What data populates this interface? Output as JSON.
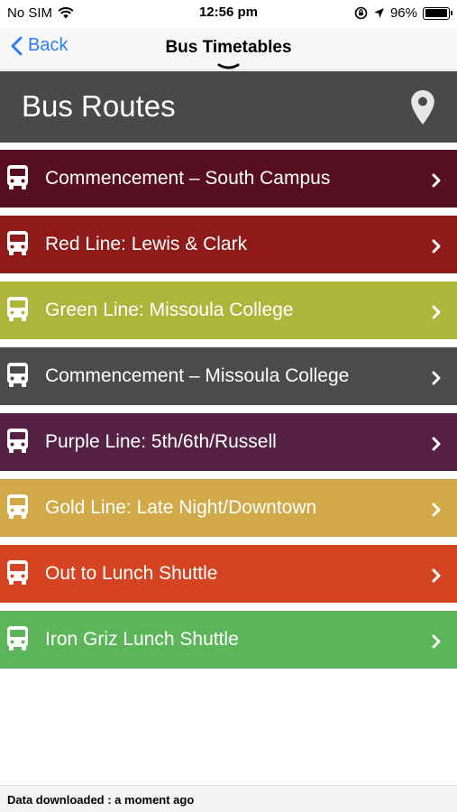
{
  "status_bar": {
    "carrier": "No SIM",
    "time": "12:56 pm",
    "battery": "96%",
    "battery_level": 0.96
  },
  "nav": {
    "back_label": "Back",
    "title": "Bus Timetables"
  },
  "banner": {
    "title": "Bus Routes",
    "icon": "map-pin-icon"
  },
  "routes": [
    {
      "label": "Commencement – South Campus",
      "color": "#570e20",
      "icon": "bus-icon"
    },
    {
      "label": "Red Line: Lewis & Clark",
      "color": "#8f1a1a",
      "icon": "bus-icon"
    },
    {
      "label": "Green Line: Missoula College",
      "color": "#adb53b",
      "icon": "bus-icon"
    },
    {
      "label": "Commencement – Missoula College",
      "color": "#4b4b4b",
      "icon": "bus-icon"
    },
    {
      "label": "Purple Line: 5th/6th/Russell",
      "color": "#552245",
      "icon": "bus-icon"
    },
    {
      "label": "Gold Line: Late Night/Downtown",
      "color": "#d2a948",
      "icon": "bus-icon"
    },
    {
      "label": "Out to Lunch Shuttle",
      "color": "#d54422",
      "icon": "bus-icon"
    },
    {
      "label": "Iron Griz Lunch Shuttle",
      "color": "#5db55a",
      "icon": "bus-icon"
    }
  ],
  "footer": {
    "text": "Data downloaded : a moment ago"
  },
  "colors": {
    "accent": "#2d7cf6",
    "banner_bg": "#494949"
  }
}
